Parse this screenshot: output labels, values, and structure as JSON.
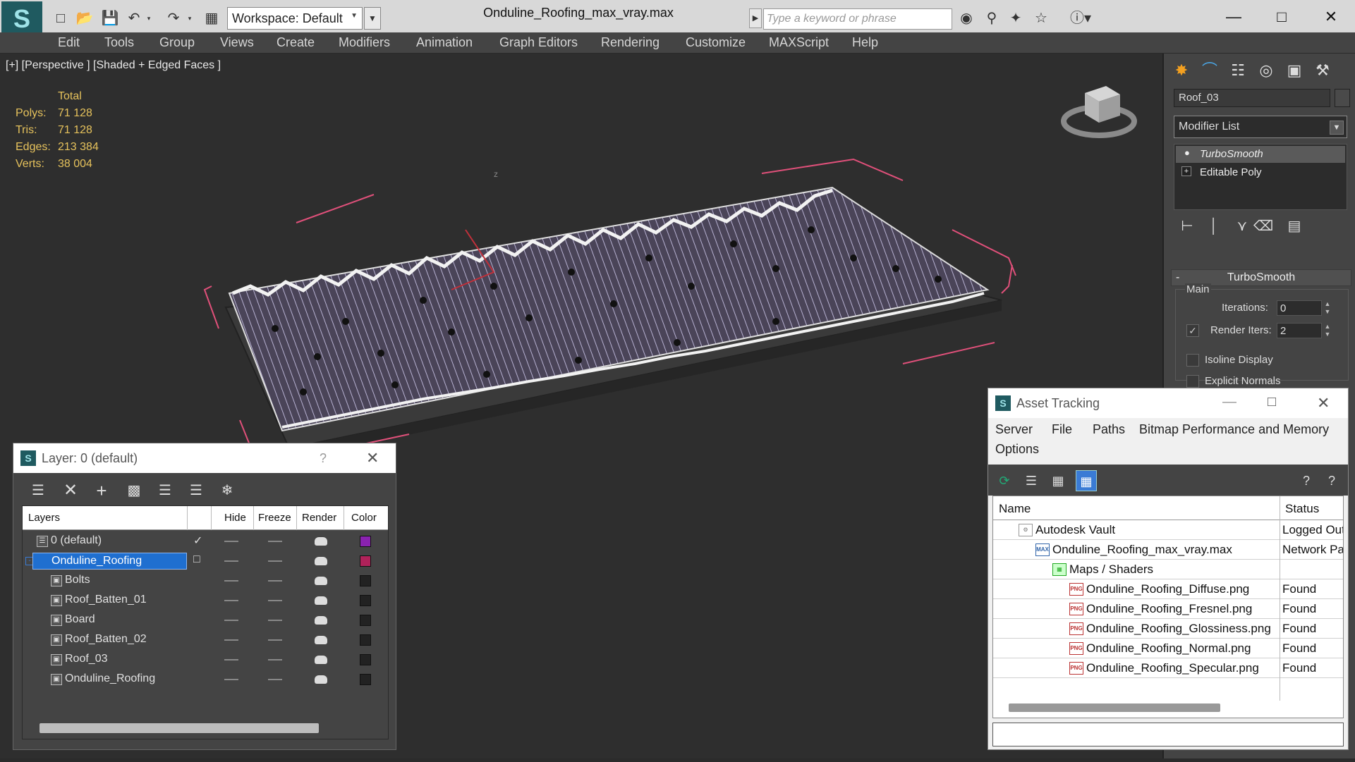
{
  "app": {
    "file_title": "Onduline_Roofing_max_vray.max",
    "workspace_label": "Workspace: Default",
    "search_placeholder": "Type a keyword or phrase"
  },
  "menu": [
    "Edit",
    "Tools",
    "Group",
    "Views",
    "Create",
    "Modifiers",
    "Animation",
    "Graph Editors",
    "Rendering",
    "Customize",
    "MAXScript",
    "Help"
  ],
  "viewport": {
    "label": "[+] [Perspective ] [Shaded + Edged Faces ]",
    "stats_header": "Total",
    "stats": [
      {
        "label": "Polys:",
        "value": "71 128"
      },
      {
        "label": "Tris:",
        "value": "71 128"
      },
      {
        "label": "Edges:",
        "value": "213 384"
      },
      {
        "label": "Verts:",
        "value": "38 004"
      }
    ],
    "axis_label": "z"
  },
  "command_panel": {
    "object_name": "Roof_03",
    "modifier_list_label": "Modifier List",
    "stack": [
      "TurboSmooth",
      "Editable Poly"
    ],
    "rollout_title": "TurboSmooth",
    "group_label": "Main",
    "iterations_label": "Iterations:",
    "iterations_value": "0",
    "render_iters_label": "Render Iters:",
    "render_iters_value": "2",
    "isoline_label": "Isoline Display",
    "explicit_normals_label": "Explicit Normals"
  },
  "layer_dialog": {
    "title": "Layer: 0 (default)",
    "help": "?",
    "columns": [
      "Layers",
      "Hide",
      "Freeze",
      "Render",
      "Color"
    ],
    "rows": [
      {
        "name": "0 (default)",
        "indent": 1,
        "color": "#8a22b0",
        "type": "layer",
        "checked": true
      },
      {
        "name": "Onduline_Roofing",
        "indent": 1,
        "color": "#b0225a",
        "type": "layer",
        "selected": true
      },
      {
        "name": "Bolts",
        "indent": 2,
        "color": "#222222",
        "type": "object"
      },
      {
        "name": "Roof_Batten_01",
        "indent": 2,
        "color": "#222222",
        "type": "object"
      },
      {
        "name": "Board",
        "indent": 2,
        "color": "#222222",
        "type": "object"
      },
      {
        "name": "Roof_Batten_02",
        "indent": 2,
        "color": "#222222",
        "type": "object"
      },
      {
        "name": "Roof_03",
        "indent": 2,
        "color": "#222222",
        "type": "object"
      },
      {
        "name": "Onduline_Roofing",
        "indent": 2,
        "color": "#222222",
        "type": "object"
      }
    ]
  },
  "asset_dialog": {
    "title": "Asset Tracking",
    "menu": [
      "Server",
      "File",
      "Paths",
      "Bitmap Performance and Memory",
      "Options"
    ],
    "columns": [
      "Name",
      "Status"
    ],
    "rows": [
      {
        "name": "Autodesk Vault",
        "status": "Logged Out",
        "level": 1,
        "icon": "vault"
      },
      {
        "name": "Onduline_Roofing_max_vray.max",
        "status": "Network Path",
        "level": 2,
        "icon": "max"
      },
      {
        "name": "Maps / Shaders",
        "status": "",
        "level": 3,
        "icon": "maps"
      },
      {
        "name": "Onduline_Roofing_Diffuse.png",
        "status": "Found",
        "level": 4,
        "icon": "png"
      },
      {
        "name": "Onduline_Roofing_Fresnel.png",
        "status": "Found",
        "level": 4,
        "icon": "png"
      },
      {
        "name": "Onduline_Roofing_Glossiness.png",
        "status": "Found",
        "level": 4,
        "icon": "png"
      },
      {
        "name": "Onduline_Roofing_Normal.png",
        "status": "Found",
        "level": 4,
        "icon": "png"
      },
      {
        "name": "Onduline_Roofing_Specular.png",
        "status": "Found",
        "level": 4,
        "icon": "png"
      }
    ]
  },
  "colors": {
    "accent_selection": "#1f6fd0",
    "stat_text": "#e6c25c",
    "selection_bracket": "#e0507a"
  }
}
